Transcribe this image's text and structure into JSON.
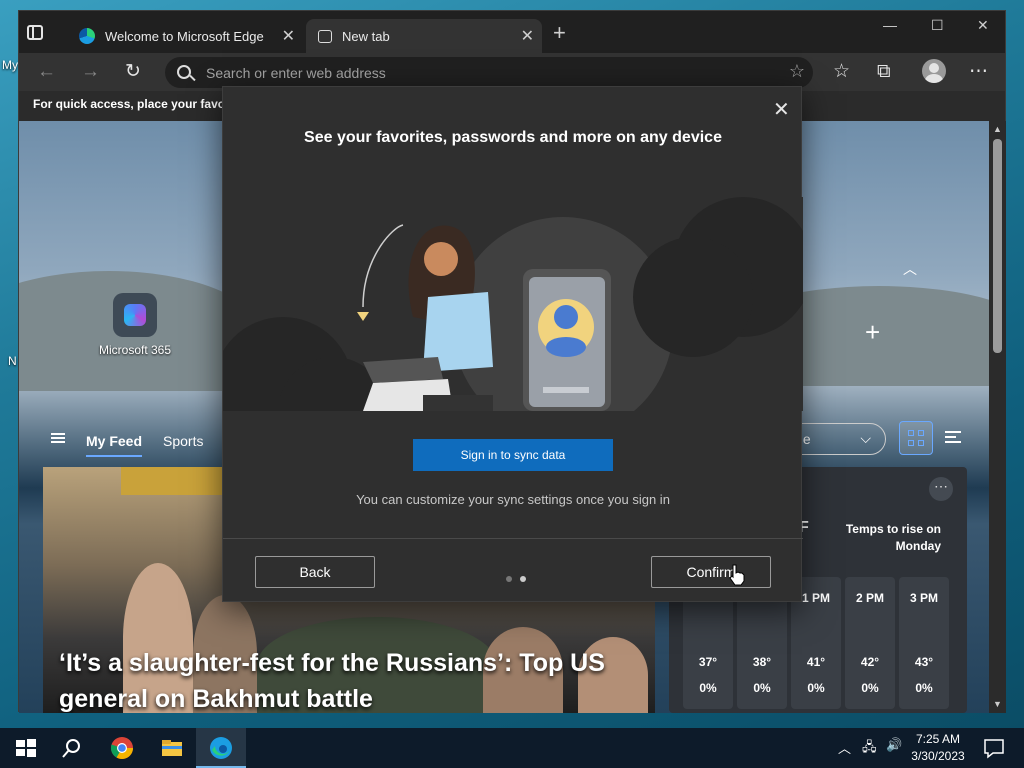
{
  "desktop": {
    "fragments": [
      "My",
      "N"
    ]
  },
  "browser": {
    "tabs": [
      {
        "title": "Welcome to Microsoft Edge",
        "icon": "edge-icon",
        "active": false
      },
      {
        "title": "New tab",
        "icon": "new-tab-icon",
        "active": true
      }
    ],
    "address_placeholder": "Search or enter web address",
    "favorites_bar_text": "For quick access, place your favorites here on the favorites bar."
  },
  "newtab": {
    "quick_links": [
      {
        "label": "Microsoft 365"
      }
    ],
    "feed_tabs": [
      "My Feed",
      "Sports"
    ],
    "layout_select_value": "ole",
    "headline": "‘It’s a slaughter-fest for the Russians’: Top US general on Bakhmut battle",
    "weather": {
      "headline": "Temps to rise on Monday",
      "partial_reading": "F",
      "hours": [
        {
          "time": "",
          "temp": "37°",
          "precip": "0%"
        },
        {
          "time": "",
          "temp": "38°",
          "precip": "0%"
        },
        {
          "time": "1 PM",
          "temp": "41°",
          "precip": "0%"
        },
        {
          "time": "2 PM",
          "temp": "42°",
          "precip": "0%"
        },
        {
          "time": "3 PM",
          "temp": "43°",
          "precip": "0%"
        }
      ]
    }
  },
  "dialog": {
    "title": "See your favorites, passwords and more on any device",
    "sign_in_button": "Sign in to sync data",
    "hint": "You can customize your sync settings once you sign in",
    "back_button": "Back",
    "confirm_button": "Confirm",
    "page_indicator": {
      "total": 2,
      "current": 2
    }
  },
  "taskbar": {
    "apps": [
      "start-icon",
      "search-icon",
      "chrome-icon",
      "file-explorer-icon",
      "edge-icon"
    ],
    "time": "7:25 AM",
    "date": "3/30/2023"
  },
  "colors": {
    "accent": "#0f6cbd",
    "dialog_bg": "#2f2f2f",
    "browser_chrome": "#202020"
  }
}
